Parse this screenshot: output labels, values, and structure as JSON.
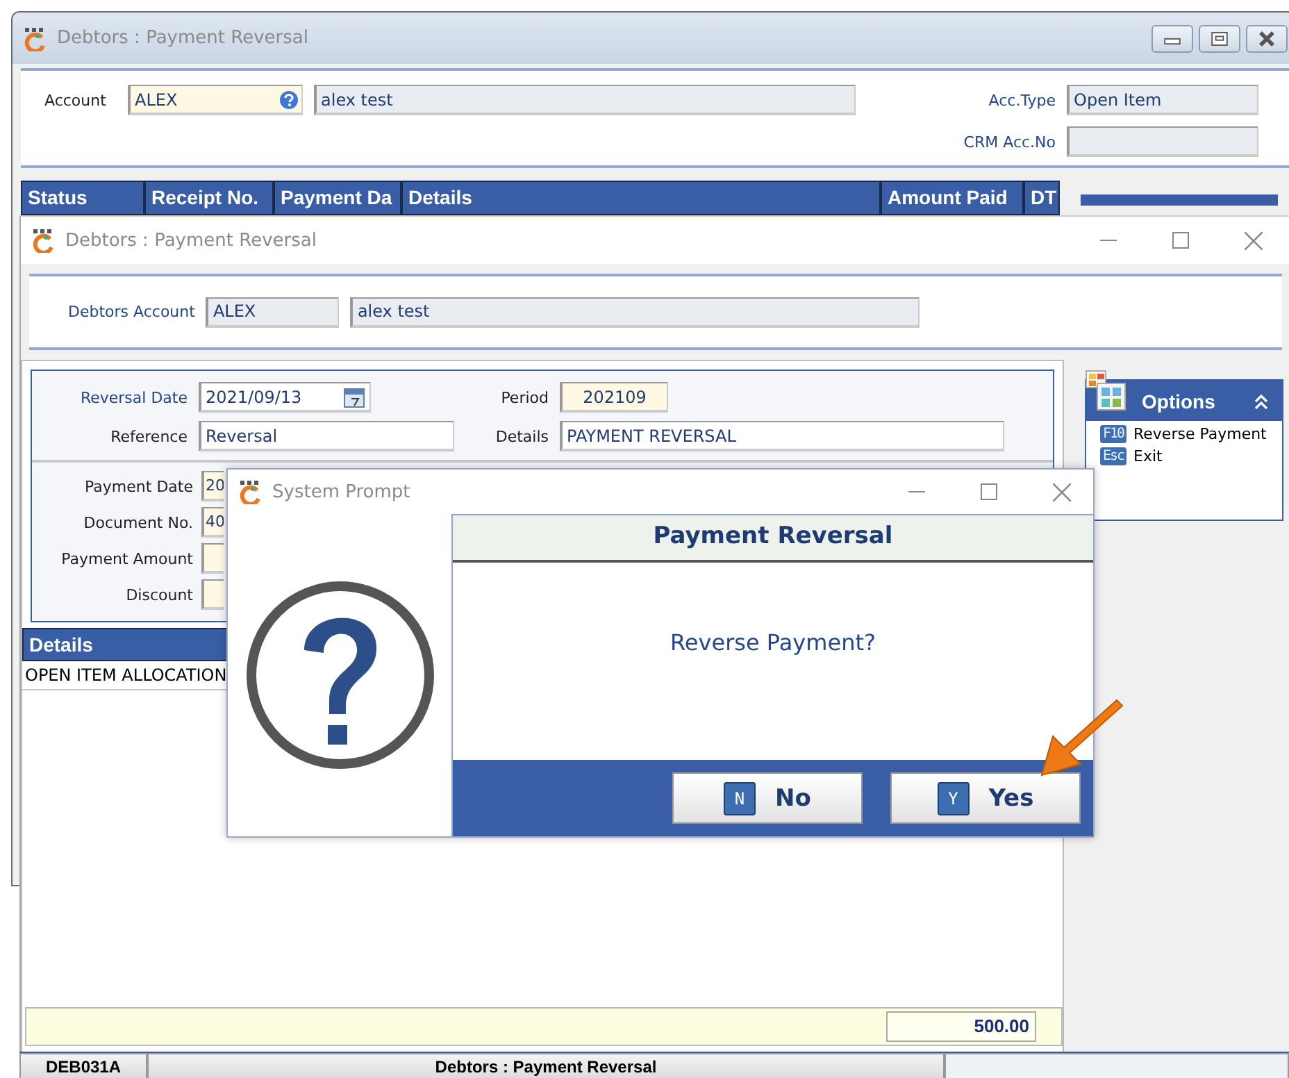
{
  "back_window": {
    "title": "Debtors : Payment Reversal",
    "account_label": "Account",
    "account_code": "ALEX",
    "account_name": "alex test",
    "acc_type_label": "Acc.Type",
    "acc_type": "Open Item",
    "crm_label": "CRM Acc.No",
    "columns": [
      "Status",
      "Receipt No.",
      "Payment Da",
      "Details",
      "Amount Paid",
      "DT"
    ]
  },
  "front_window": {
    "title": "Debtors : Payment Reversal",
    "account_label": "Debtors Account",
    "account_code": "ALEX",
    "account_name": "alex test",
    "top_fields": [
      {
        "label": "Reversal Date",
        "value": "2021/09/13",
        "kind": "date"
      },
      {
        "label": "Period",
        "value": "202109",
        "kind": "readonly"
      },
      {
        "label": "Reference",
        "value": "Reversal",
        "kind": "text"
      },
      {
        "label": "Details",
        "value": "PAYMENT REVERSAL",
        "kind": "text"
      }
    ],
    "payment_fields": [
      {
        "label": "Payment Date",
        "value": "20"
      },
      {
        "label": "Document No.",
        "value": "40"
      },
      {
        "label": "Payment Amount"
      },
      {
        "label": "Discount"
      }
    ],
    "details": {
      "column": "Details",
      "rows": [
        "OPEN ITEM ALLOCATION"
      ]
    },
    "total": "500.00",
    "options": {
      "title": "Options",
      "items": [
        {
          "key": "F10",
          "label": "Reverse Payment"
        },
        {
          "key": "Esc",
          "label": "Exit"
        }
      ]
    }
  },
  "dialog": {
    "title": "System Prompt",
    "heading": "Payment Reversal",
    "message": "Reverse Payment?",
    "buttons": [
      {
        "key": "N",
        "label": "No"
      },
      {
        "key": "Y",
        "label": "Yes"
      }
    ]
  },
  "status_bar": [
    "DEB031A",
    "Debtors : Payment Reversal"
  ]
}
